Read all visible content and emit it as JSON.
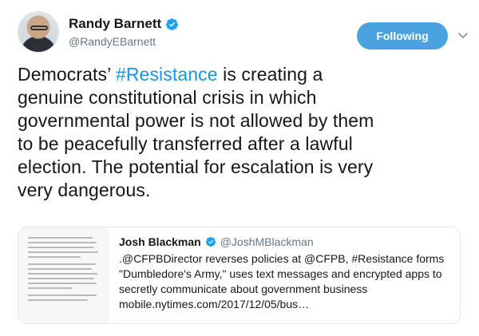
{
  "author": {
    "display_name": "Randy Barnett",
    "handle": "@RandyEBarnett",
    "verified_icon": "verified-badge-icon"
  },
  "follow_button": {
    "label": "Following"
  },
  "menu": {
    "icon": "chevron-down-icon"
  },
  "tweet": {
    "lines": [
      {
        "before": "Democrats’ ",
        "hashtag": "#Resistance",
        "after": " is creating a"
      },
      {
        "text": "genuine constitutional crisis in which"
      },
      {
        "text": "governmental power is not allowed by them"
      },
      {
        "text": "to be peacefully transferred after a lawful"
      },
      {
        "text": "election. The potential for escalation is very"
      },
      {
        "text": "very dangerous."
      }
    ]
  },
  "quoted_tweet": {
    "display_name": "Josh Blackman",
    "handle": "@JoshMBlackman",
    "lines": [
      ".@CFPBDirector reverses policies at @CFPB, #Resistance forms",
      " \"Dumbledore's Army,\" uses text messages and encrypted apps to",
      "secretly communicate about government business",
      "mobile.nytimes.com/2017/12/05/bus…"
    ]
  },
  "colors": {
    "accent": "#1b95e0",
    "follow_button_bg": "#4aa3df",
    "secondary_text": "#657786",
    "border": "#e1e8ed"
  }
}
